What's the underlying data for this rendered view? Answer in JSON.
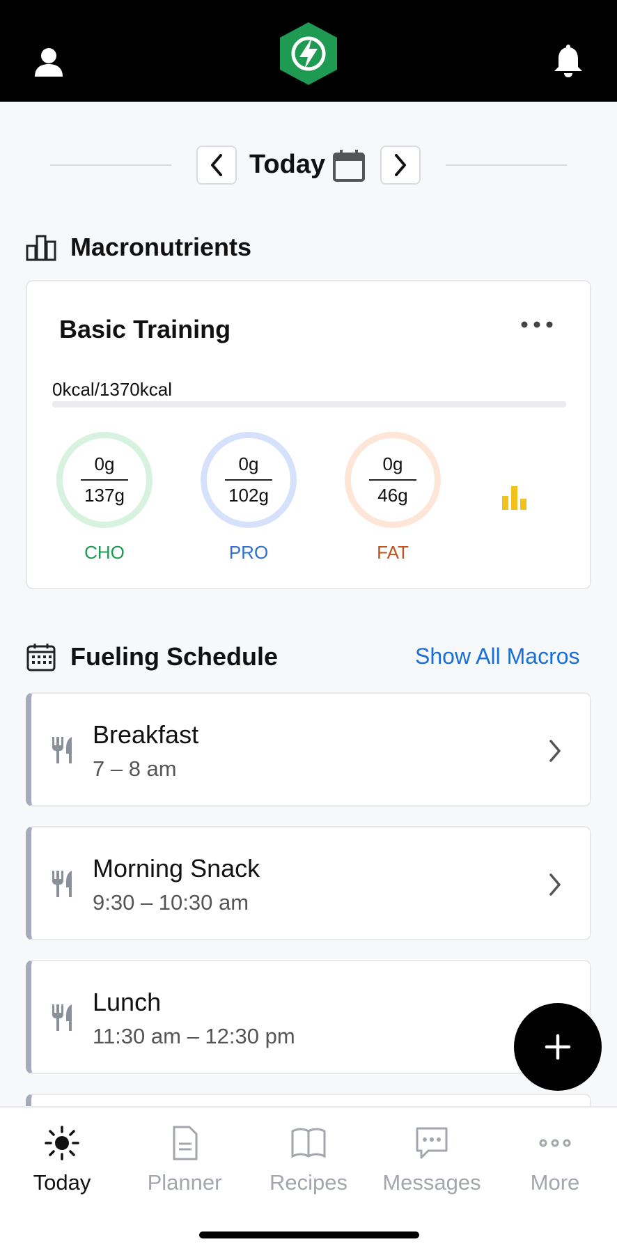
{
  "header": {
    "user_icon": "user-icon",
    "logo_icon": "hexagon-lightning-logo",
    "bell_icon": "bell-icon"
  },
  "date_nav": {
    "label": "Today",
    "prev_icon": "chevron-left-icon",
    "next_icon": "chevron-right-icon",
    "calendar_icon": "calendar-icon"
  },
  "macronutrients": {
    "section_title": "Macronutrients",
    "plan_name": "Basic Training",
    "calories": "0kcal/1370kcal",
    "calories_progress": 0,
    "macros": [
      {
        "label": "CHO",
        "current": "0g",
        "total": "137g",
        "color": "#1e9a52",
        "ring_color": "#d7f3df"
      },
      {
        "label": "PRO",
        "current": "0g",
        "total": "102g",
        "color": "#2e6fd0",
        "ring_color": "#d6e2fb"
      },
      {
        "label": "FAT",
        "current": "0g",
        "total": "46g",
        "color": "#c4521a",
        "ring_color": "#fde6d8"
      }
    ]
  },
  "fueling": {
    "section_title": "Fueling Schedule",
    "show_all": "Show All Macros",
    "meals": [
      {
        "name": "Breakfast",
        "time": "7 – 8 am"
      },
      {
        "name": "Morning Snack",
        "time": "9:30 – 10:30 am"
      },
      {
        "name": "Lunch",
        "time": "11:30 am – 12:30 pm"
      }
    ]
  },
  "tabs": [
    {
      "label": "Today",
      "icon": "sun-icon",
      "active": true
    },
    {
      "label": "Planner",
      "icon": "document-icon",
      "active": false
    },
    {
      "label": "Recipes",
      "icon": "book-icon",
      "active": false
    },
    {
      "label": "Messages",
      "icon": "chat-icon",
      "active": false
    },
    {
      "label": "More",
      "icon": "more-dots-icon",
      "active": false
    }
  ],
  "colors": {
    "accent_blue": "#1a6fd6",
    "logo_green": "#1e9a52",
    "chart_yellow": "#f2c21b"
  }
}
